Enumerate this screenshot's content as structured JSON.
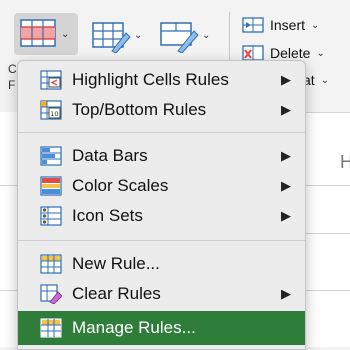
{
  "ribbon": {
    "insert_label": "Insert",
    "delete_label": "Delete",
    "format_label": "at",
    "clip_line1": "C",
    "clip_line2": "F",
    "clip_edge": "H"
  },
  "menu": {
    "items": [
      {
        "label": "Highlight Cells Rules",
        "icon": "highlight-cells-icon",
        "submenu": true
      },
      {
        "label": "Top/Bottom Rules",
        "icon": "top-bottom-icon",
        "submenu": true
      },
      {
        "label": "Data Bars",
        "icon": "data-bars-icon",
        "submenu": true
      },
      {
        "label": "Color Scales",
        "icon": "color-scales-icon",
        "submenu": true
      },
      {
        "label": "Icon Sets",
        "icon": "icon-sets-icon",
        "submenu": true
      },
      {
        "label": "New Rule...",
        "icon": "new-rule-icon",
        "submenu": false
      },
      {
        "label": "Clear Rules",
        "icon": "clear-rules-icon",
        "submenu": true
      },
      {
        "label": "Manage Rules...",
        "icon": "manage-rules-icon",
        "submenu": false,
        "highlighted": true
      }
    ],
    "submenu_arrow": "▶"
  },
  "colors": {
    "highlight": "#2e7d3b",
    "menu_bg": "#ececec",
    "accent_red": "#e24b4b",
    "accent_blue": "#2f6fb5"
  }
}
